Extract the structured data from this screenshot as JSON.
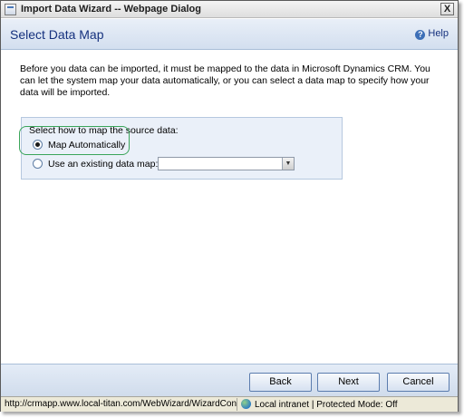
{
  "window": {
    "title": "Import Data Wizard -- Webpage Dialog",
    "close_label": "X"
  },
  "header": {
    "title": "Select Data Map",
    "help_label": "Help"
  },
  "intro_text": "Before you data can be imported, it must be mapped to the data in Microsoft Dynamics CRM. You can let the system map your data automatically, or you can select a data map to specify how your data will be imported.",
  "map_options": {
    "label": "Select how to map the source data:",
    "option_auto": "Map Automatically",
    "option_existing": "Use an existing data map:",
    "selected": "Map Automatically",
    "existing_map_value": ""
  },
  "footer": {
    "back": "Back",
    "next": "Next",
    "cancel": "Cancel"
  },
  "status": {
    "url": "http://crmapp.www.local-titan.com/WebWizard/WizardContainer",
    "zone": "Local intranet | Protected Mode: Off"
  },
  "colors": {
    "header_title": "#15317e",
    "highlight_border": "#3aa55a"
  }
}
